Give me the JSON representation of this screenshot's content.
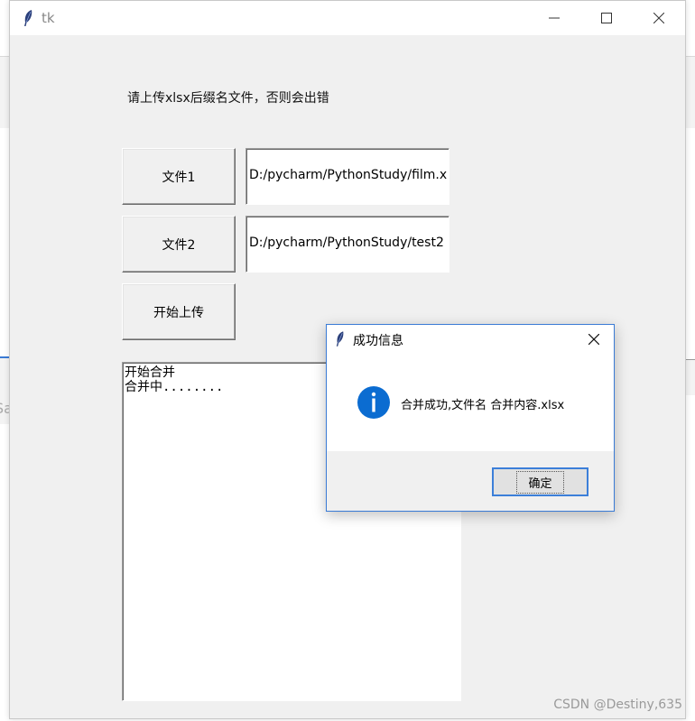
{
  "window": {
    "title": "tk"
  },
  "instruction": "请上传xlsx后缀名文件，否则会出错",
  "buttons": {
    "file1": "文件1",
    "file2": "文件2",
    "start": "开始上传"
  },
  "entries": {
    "file1_value": "D:/pycharm/PythonStudy/film.x",
    "file2_value": "D:/pycharm/PythonStudy/test2"
  },
  "log": {
    "lines": [
      "开始合并",
      "合并中........"
    ]
  },
  "dialog": {
    "title": "成功信息",
    "message": "合并成功,文件名 合并内容.xlsx",
    "ok_label": "确定"
  },
  "background": {
    "edge_text": "Sa"
  },
  "watermark": "CSDN @Destiny,635",
  "colors": {
    "accent": "#3c7fd9",
    "info_icon": "#0b6cd1",
    "window_bg": "#f0f0f0"
  },
  "icons": {
    "app": "feather-icon",
    "minimize": "minimize-icon",
    "maximize": "maximize-icon",
    "close": "close-icon",
    "info": "info-icon"
  }
}
